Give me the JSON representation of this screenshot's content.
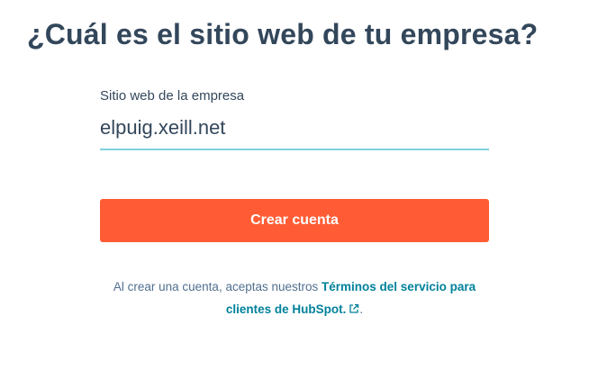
{
  "heading": "¿Cuál es el sitio web de tu empresa?",
  "form": {
    "website_label": "Sitio web de la empresa",
    "website_value": "elpuig.xeill.net"
  },
  "submit_label": "Crear cuenta",
  "legal": {
    "prefix": "Al crear una cuenta, aceptas nuestros",
    "terms_link": "Términos del servicio para clientes de HubSpot.",
    "suffix": "."
  },
  "icons": {
    "terms_external": "external-link-icon"
  },
  "colors": {
    "primary_button": "#ff5c35",
    "heading_text": "#33475b",
    "link": "#00819a",
    "input_underline": "#7fd1de"
  }
}
